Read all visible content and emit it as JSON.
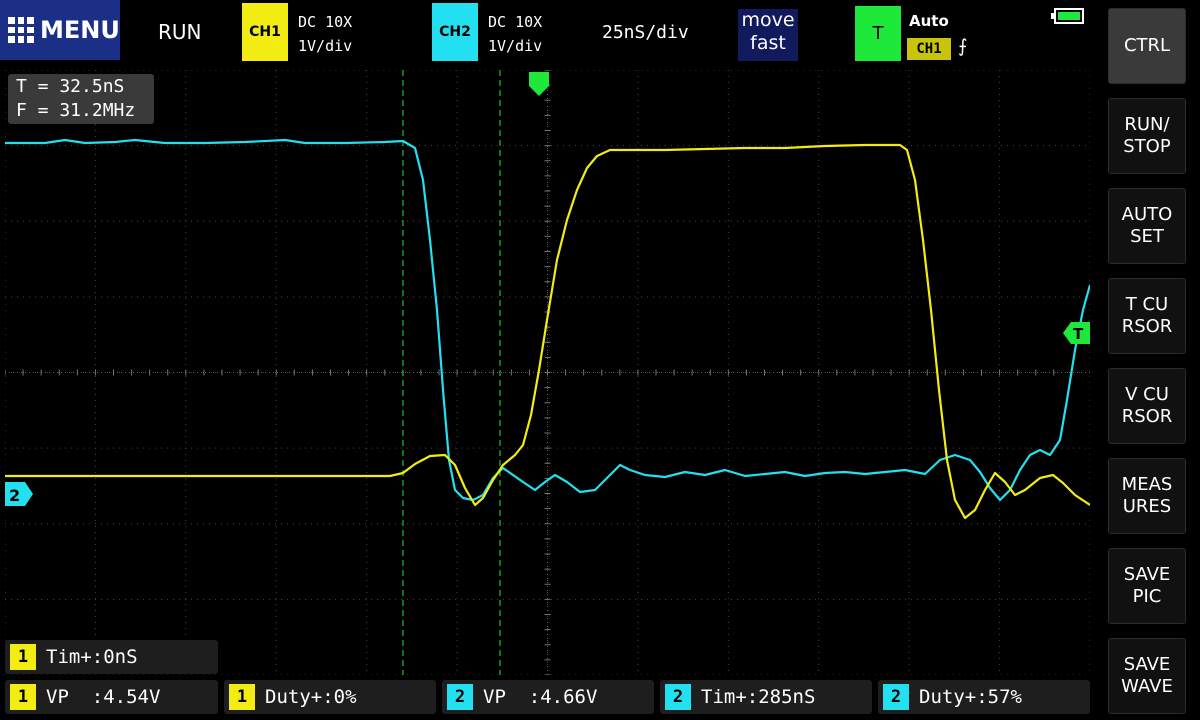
{
  "header": {
    "menu_label": "MENU",
    "run_state": "RUN",
    "ch1": {
      "badge": "CH1",
      "coupling": "DC 10X",
      "scale": "1V/div",
      "color": "#f2ec12"
    },
    "ch2": {
      "badge": "CH2",
      "coupling": "DC 10X",
      "scale": "1V/div",
      "color": "#22e0ef"
    },
    "timebase": "25nS/div",
    "move_mode": "move\nfast",
    "trigger": {
      "badge": "T",
      "mode": "Auto",
      "source": "CH1",
      "edge_icon": "rising-edge-icon",
      "edge_glyph": "⨍"
    },
    "battery": {
      "icon": "battery-icon",
      "level": 1.0
    }
  },
  "sidebar": [
    {
      "label": "CTRL",
      "active": true
    },
    {
      "label": "RUN/\nSTOP"
    },
    {
      "label": "AUTO\nSET"
    },
    {
      "label": "T CU\nRSOR"
    },
    {
      "label": "V CU\nRSOR"
    },
    {
      "label": "MEAS\nURES"
    },
    {
      "label": "SAVE\nPIC"
    },
    {
      "label": "SAVE\nWAVE"
    }
  ],
  "cursor_readout": {
    "t": "T = 32.5nS",
    "f": "F = 31.2MHz"
  },
  "markers": {
    "ch2_ground": "2",
    "trigger_level": "T"
  },
  "measurements": [
    {
      "ch": "1",
      "text": "Tim+:0nS"
    },
    {
      "ch": "1",
      "text": "VP  :4.54V"
    },
    {
      "ch": "1",
      "text": "Duty+:0%"
    },
    {
      "ch": "2",
      "text": "VP  :4.66V"
    },
    {
      "ch": "2",
      "text": "Tim+:285nS"
    },
    {
      "ch": "2",
      "text": "Duty+:57%"
    }
  ],
  "colors": {
    "ch1": "#f2ec12",
    "ch2": "#22e0ef",
    "trigger": "#1ee83a",
    "grid": "#444444"
  }
}
